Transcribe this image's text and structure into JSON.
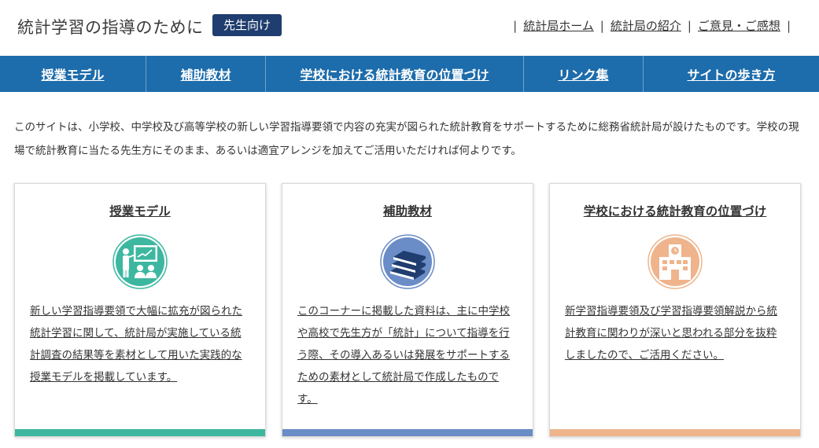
{
  "header": {
    "site_title": "統計学習の指導のために",
    "badge": "先生向け",
    "links": [
      "統計局ホーム",
      "統計局の紹介",
      "ご意見・ご感想"
    ]
  },
  "nav": {
    "items": [
      "授業モデル",
      "補助教材",
      "学校における統計教育の位置づけ",
      "リンク集",
      "サイトの歩き方"
    ]
  },
  "intro": "このサイトは、小学校、中学校及び高等学校の新しい学習指導要領で内容の充実が図られた統計教育をサポートするために総務省統計局が設けたものです。学校の現場で統計教育に当たる先生方にそのまま、あるいは適宜アレンジを加えてご活用いただければ何よりです。",
  "cards": [
    {
      "title": "授業モデル",
      "icon": "teacher-presentation-icon",
      "text": "新しい学習指導要領で大幅に拡充が図られた統計学習に関して、統計局が実施している統計調査の結果等を素材として用いた実践的な授業モデルを掲載しています。",
      "color": "#3db7a0"
    },
    {
      "title": "補助教材",
      "icon": "books-icon",
      "text": "このコーナーに掲載した資料は、主に中学校や高校で先生方が「統計」について指導を行う際、その導入あるいは発展をサポートするための素材として統計局で作成したものです。",
      "color": "#6a8cc7"
    },
    {
      "title": "学校における統計教育の位置づけ",
      "icon": "school-building-icon",
      "text": "新学習指導要領及び学習指導要領解説から統計教育に関わりが深いと思われる部分を抜粋しましたので、ご活用ください。",
      "color": "#efb48c"
    }
  ]
}
